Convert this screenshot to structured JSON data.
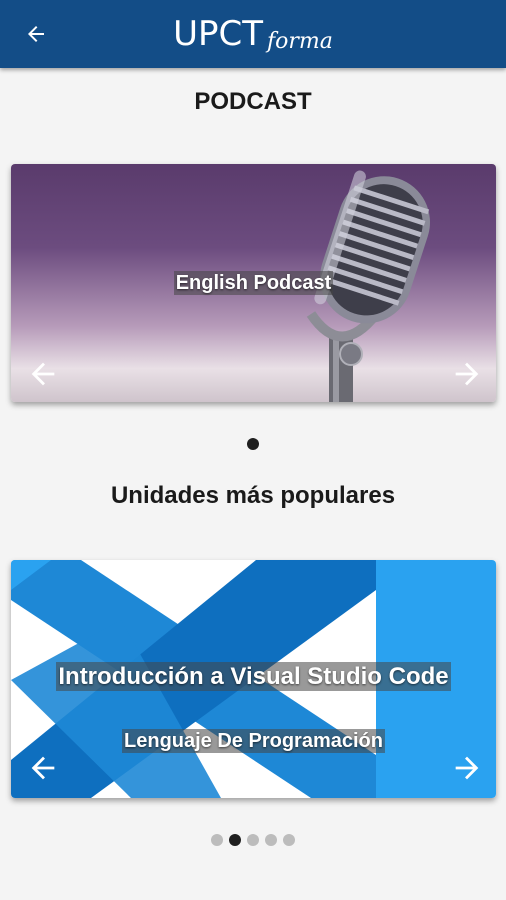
{
  "appbar": {
    "back_icon": "arrow-left-icon",
    "logo_main": "UPCT",
    "logo_sub": "forma",
    "bg_color": "#134d87"
  },
  "podcast_section": {
    "title": "PODCAST",
    "slides": [
      {
        "caption": "English Podcast",
        "image": "microphone-photo"
      }
    ],
    "active_index": 0,
    "prev_icon": "arrow-left-icon",
    "next_icon": "arrow-right-icon"
  },
  "popular_section": {
    "title": "Unidades más populares",
    "slides_count": 5,
    "active_index": 1,
    "current_slide": {
      "title": "Introducción a Visual Studio Code",
      "subtitle": "Lenguaje De Programación",
      "image": "vscode-logo"
    },
    "prev_icon": "arrow-left-icon",
    "next_icon": "arrow-right-icon",
    "accent_colors": [
      "#1e88d6",
      "#0e6fbf",
      "#2aa2f0"
    ]
  }
}
